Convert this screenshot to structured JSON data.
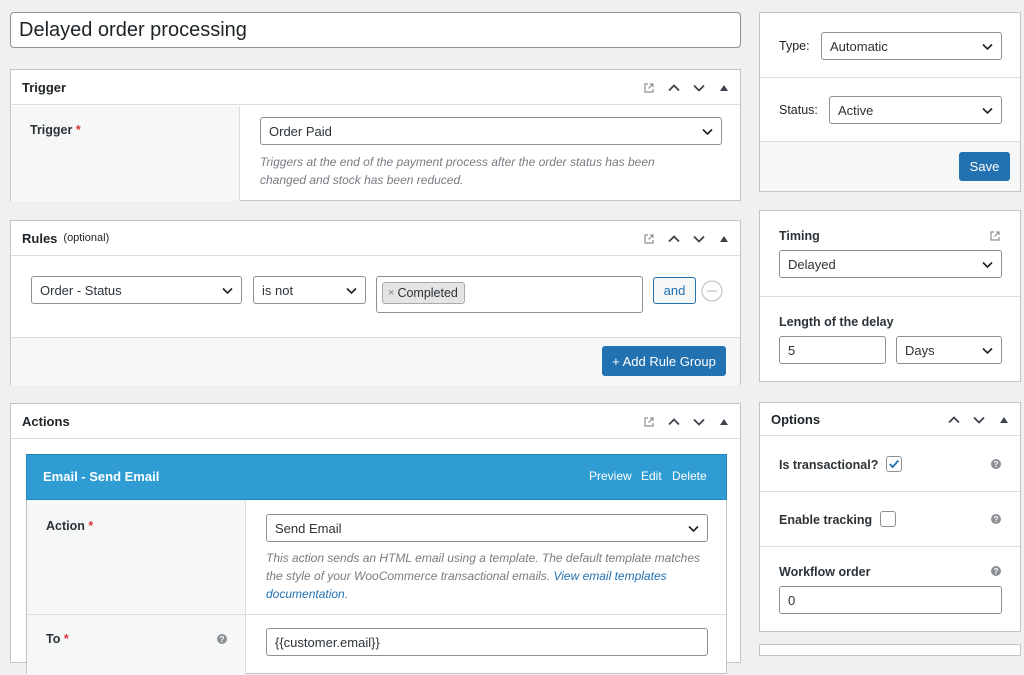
{
  "workflow": {
    "title": "Delayed order processing"
  },
  "trigger": {
    "heading": "Trigger",
    "field_label": "Trigger",
    "required_mark": "*",
    "selected": "Order Paid",
    "description": "Triggers at the end of the payment process after the order status has been changed and stock has been reduced."
  },
  "rules": {
    "heading": "Rules",
    "optional": "(optional)",
    "field": "Order - Status",
    "compare": "is not",
    "tag": "Completed",
    "tag_remove": "×",
    "and_label": "and",
    "add_group_label": "+ Add Rule Group"
  },
  "actions": {
    "heading": "Actions",
    "action_title": "Email - Send Email",
    "preview": "Preview",
    "edit": "Edit",
    "delete": "Delete",
    "action_label": "Action",
    "required_mark": "*",
    "action_value": "Send Email",
    "action_desc": "This action sends an HTML email using a template. The default template matches the style of your WooCommerce transactional emails.",
    "action_link": "View email templates documentation",
    "action_desc_end": ".",
    "to_label": "To",
    "to_value": "{{customer.email}}"
  },
  "publish": {
    "type_label": "Type:",
    "type_value": "Automatic",
    "status_label": "Status:",
    "status_value": "Active",
    "save_label": "Save"
  },
  "timing": {
    "heading": "Timing",
    "value": "Delayed",
    "delay_label": "Length of the delay",
    "delay_amount": "5",
    "delay_unit": "Days"
  },
  "options": {
    "heading": "Options",
    "transactional_label": "Is transactional?",
    "transactional_checked": true,
    "tracking_label": "Enable tracking",
    "tracking_checked": false,
    "order_label": "Workflow order",
    "order_value": "0",
    "help_glyph": "?"
  },
  "colors": {
    "accent": "#2271b1",
    "action_header": "#2f9dd4",
    "required": "#d63638"
  },
  "icons": [
    "external-link-icon",
    "chevron-up-icon",
    "chevron-down-icon",
    "triangle-up-icon",
    "remove-circle-icon",
    "checkmark-icon",
    "help-icon"
  ]
}
